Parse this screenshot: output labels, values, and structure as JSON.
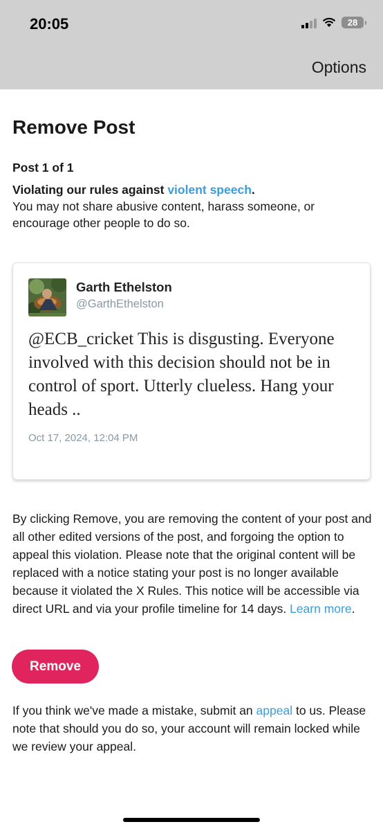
{
  "status_bar": {
    "time": "20:05",
    "battery": "28",
    "icons": [
      "cellular-signal-icon",
      "wifi-icon",
      "battery-icon"
    ]
  },
  "nav": {
    "options_label": "Options"
  },
  "page": {
    "title": "Remove Post",
    "post_count": "Post 1 of 1",
    "violation_prefix": "Violating our rules against ",
    "violation_link": "violent speech",
    "violation_suffix": ".",
    "violation_description": "You may not share abusive content, harass someone, or encourage other people to do so."
  },
  "tweet": {
    "author_name": "Garth Ethelston",
    "author_handle": "@GarthEthelston",
    "text": "@ECB_cricket This is disgusting. Everyone involved with this decision should not be in control of sport. Utterly clueless. Hang your heads ..",
    "timestamp": "Oct 17, 2024, 12:04 PM"
  },
  "disclaimer": {
    "text": "By clicking Remove, you are removing the content of your post and all other edited versions of the post, and forgoing the option to appeal this violation. Please note that the original content will be replaced with a notice stating your post is no longer available because it violated the X Rules. This notice will be accessible via direct URL and via your profile timeline for 14 days. ",
    "link": "Learn more",
    "suffix": "."
  },
  "actions": {
    "remove_label": "Remove"
  },
  "appeal": {
    "prefix": "If you think we've made a mistake, submit an ",
    "link": "appeal",
    "suffix": " to us. Please note that should you do so, your account will remain locked while we review your appeal."
  },
  "colors": {
    "accent_link": "#3b9ddd",
    "remove_button": "#e0245e",
    "header_bg": "#d0d0d0",
    "muted_text": "#8899a6"
  }
}
